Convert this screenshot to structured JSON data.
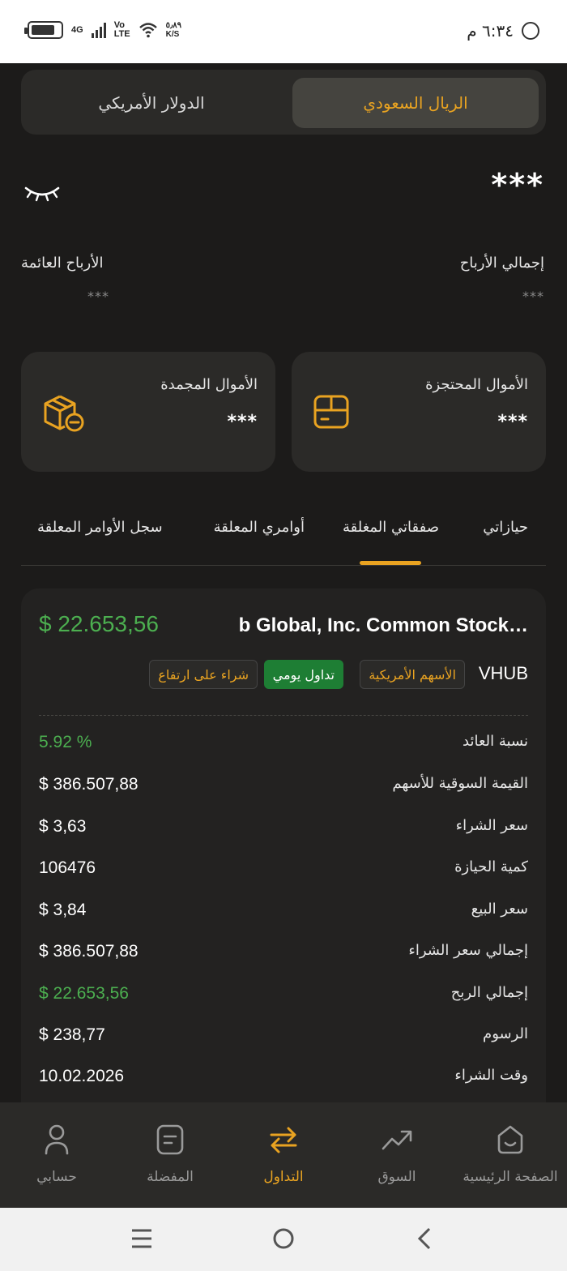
{
  "status_bar": {
    "net_4g": "4G",
    "volte": "Vo\nLTE",
    "speed": "٥٫٨٩\nK/S",
    "time": "٦:٣٤ م"
  },
  "currency": {
    "sar_label": "الريال السعودي",
    "usd_label": "الدولار الأمريكي",
    "selected": "sar"
  },
  "balance": {
    "value": "***",
    "total_profit_label": "إجمالي الأرباح",
    "total_profit_value": "***",
    "floating_profit_label": "الأرباح العائمة",
    "floating_profit_value": "***"
  },
  "funds": {
    "reserved_label": "الأموال المحتجزة",
    "reserved_value": "***",
    "frozen_label": "الأموال المجمدة",
    "frozen_value": "***"
  },
  "tabs": {
    "holdings": "حيازاتي",
    "closed_trades": "صفقاتي المغلقة",
    "pending_orders": "أوامري المعلقة",
    "pending_history": "سجل الأوامر المعلقة",
    "active": "closed_trades"
  },
  "trade": {
    "name": "b Global, Inc. Common Stock…",
    "profit": "$ 22.653,56",
    "symbol": "VHUB",
    "badge_market": "الأسهم الأمريكية",
    "badge_type": "تداول يومي",
    "badge_side": "شراء على ارتفاع",
    "rows": [
      {
        "label": "نسبة العائد",
        "value": "5.92 %",
        "green": true
      },
      {
        "label": "القيمة السوقية للأسهم",
        "value": "$ 386.507,88",
        "green": false
      },
      {
        "label": "سعر الشراء",
        "value": "$ 3,63",
        "green": false
      },
      {
        "label": "كمية الحيازة",
        "value": "106476",
        "green": false
      },
      {
        "label": "سعر البيع",
        "value": "$ 3,84",
        "green": false
      },
      {
        "label": "إجمالي سعر الشراء",
        "value": "$ 386.507,88",
        "green": false
      },
      {
        "label": "إجمالي الربح",
        "value": "$ 22.653,56",
        "green": true
      },
      {
        "label": "الرسوم",
        "value": "$ 238,77",
        "green": false
      },
      {
        "label": "وقت الشراء",
        "value": "10.02.2026",
        "green": false
      }
    ]
  },
  "bottom_nav": {
    "home": "الصفحة الرئيسية",
    "market": "السوق",
    "trading": "التداول",
    "favorites": "المفضلة",
    "account": "حسابي",
    "active": "trading"
  },
  "colors": {
    "accent": "#e9a321",
    "positive": "#4caf50",
    "background": "#1c1b1a",
    "card": "#2b2a28"
  }
}
